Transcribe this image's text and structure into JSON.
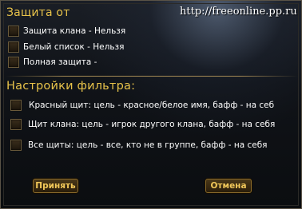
{
  "protection": {
    "title": "Защита от",
    "options": [
      {
        "label": "Защита клана - Нельзя",
        "checked": false
      },
      {
        "label": "Белый список - Нельзя",
        "checked": false
      },
      {
        "label": "Полная защита -",
        "checked": false
      }
    ]
  },
  "watermark": "http://freeonline.pp.ru",
  "filter": {
    "title": "Настройки фильтра:",
    "options": [
      {
        "label": "Красный щит: цель - красное/белое имя, бафф - на себ",
        "checked": false
      },
      {
        "label": "Щит клана: цель - игрок другого клана, бафф - на себя",
        "checked": false
      },
      {
        "label": "Все щиты: цель - все, кто не в группе, бафф - на себя",
        "checked": false
      }
    ]
  },
  "buttons": {
    "accept": "Принять",
    "cancel": "Отмена"
  },
  "colors": {
    "title": "#e8c34a",
    "button_text": "#f2c85a",
    "text": "#ffffff"
  }
}
